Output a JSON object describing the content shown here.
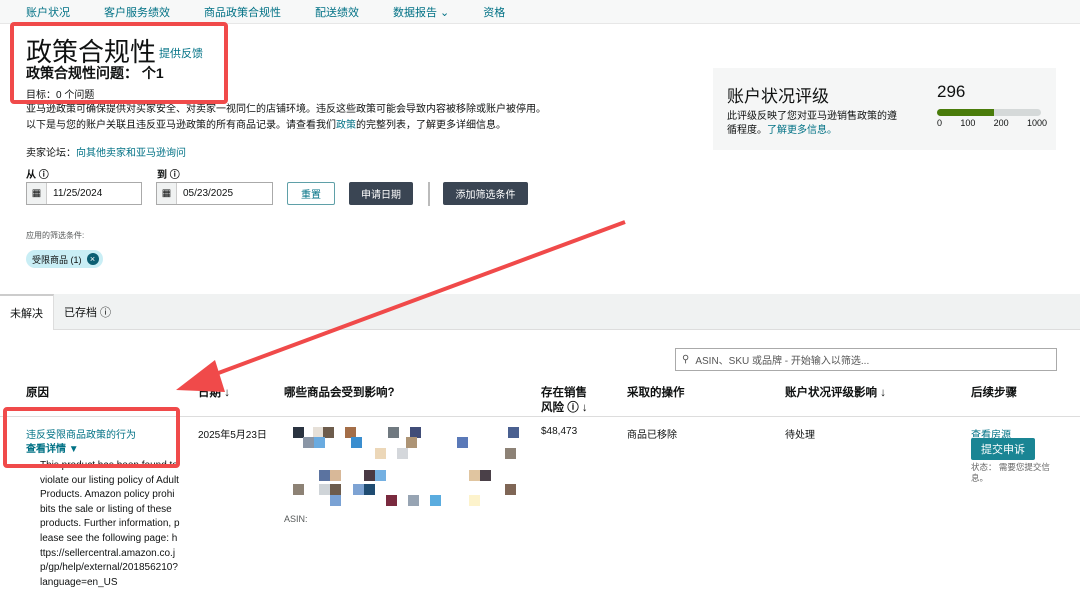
{
  "nav": [
    "账户状况",
    "客户服务绩效",
    "商品政策合规性",
    "配送绩效",
    "数据报告 ⌄",
    "资格"
  ],
  "header": {
    "title": "政策合规性",
    "feedback": "提供反馈",
    "issues": "政策合规性问题： 个1",
    "goal": "目标：0 个问题"
  },
  "description": {
    "text_before": "亚马逊政策可确保提供对买家安全、对卖家一视同仁的店铺环境。违反这些政策可能会导致内容被移除或账户被停用。以下是与您的账户关联且违反亚马逊政策的所有商品记录。请查看我们",
    "link": "政策",
    "text_after": "的完整列表，了解更多详细信息。"
  },
  "forum": {
    "label": "卖家论坛：",
    "link": "向其他卖家和亚马逊询问"
  },
  "filters": {
    "from_label": "从 ⓘ",
    "to_label": "到 ⓘ",
    "from": "11/25/2024",
    "to": "05/23/2025",
    "reset": "重置",
    "apply": "申请日期",
    "add": "添加筛选条件",
    "applied_label": "应用的筛选条件:",
    "chip": "受限商品 (1)"
  },
  "rating": {
    "title": "账户状况评级",
    "desc": "此评级反映了您对亚马逊销售政策的遵循程度。",
    "learn": "了解更多信息。",
    "score": "296",
    "ticks": [
      "0",
      "100",
      "200",
      "1000"
    ],
    "fill_percent": 55
  },
  "tabs": [
    "未解决",
    "已存档 ⓘ"
  ],
  "search": {
    "placeholder": "ASIN、SKU 或品牌 - 开始输入以筛选..."
  },
  "table": {
    "headers": [
      "原因",
      "日期 ↓",
      "哪些商品会受到影响?",
      "存在销售\n风险 ⓘ ↓",
      "采取的操作",
      "账户状况评级影响 ↓",
      "后续步骤"
    ],
    "row": {
      "reason": "违反受限商品政策的行为",
      "details_toggle": "查看详情 ▼",
      "details": "This product has been found to violate our listing policy of Adult Products. Amazon policy prohibits the sale or listing of these products. Further information, please see the following page: https://sellercentral.amazon.co.jp/gp/help/external/201856210?language=en_US",
      "date": "2025年5月23日",
      "asin_label": "ASIN:",
      "risk": "$48,473",
      "action": "商品已移除",
      "impact": "待处理",
      "view": "查看房源",
      "appeal": "提交申诉",
      "status": "状态： 需要您提交信息。"
    }
  }
}
